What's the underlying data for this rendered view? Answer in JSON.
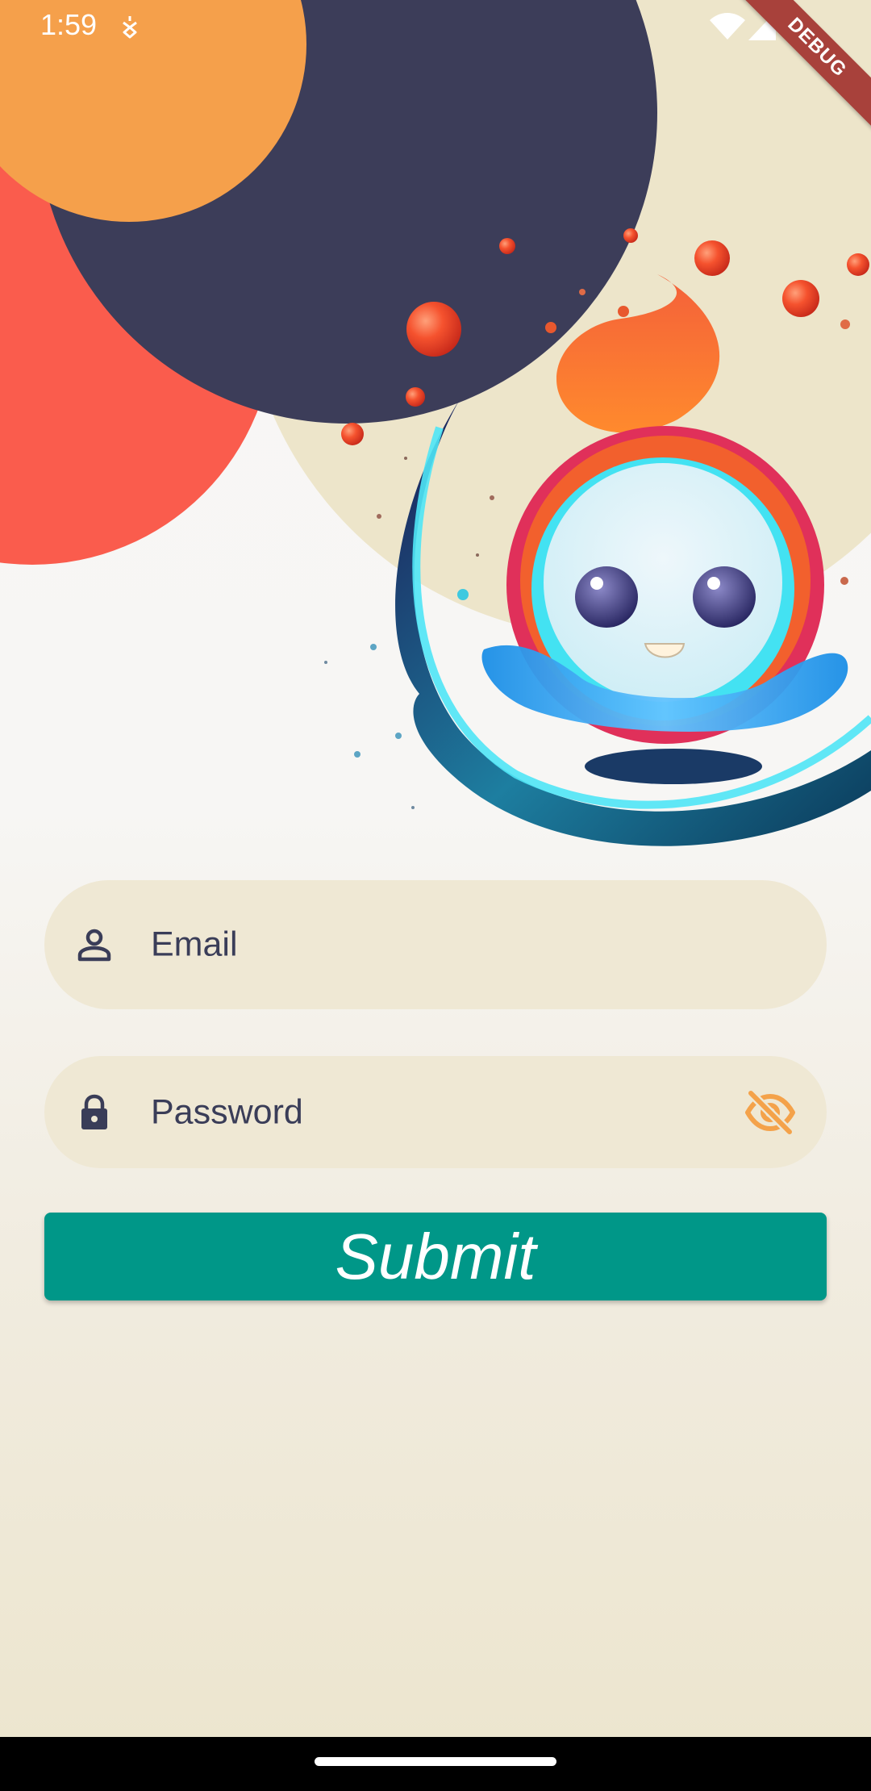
{
  "status_bar": {
    "time": "1:59",
    "icons": [
      "notification-icon",
      "wifi-icon",
      "signal-icon"
    ]
  },
  "debug_banner": {
    "label": "DEBUG"
  },
  "login_form": {
    "email": {
      "placeholder": "Email",
      "value": "",
      "icon": "person-icon"
    },
    "password": {
      "placeholder": "Password",
      "value": "",
      "icon": "lock-icon",
      "toggle_icon": "eye-off-icon"
    },
    "submit_label": "Submit"
  },
  "colors": {
    "accent_orange": "#f5a04b",
    "accent_red": "#fa5c4d",
    "dark_navy": "#3c3d59",
    "cream": "#efe8d4",
    "submit_teal": "#009788",
    "toggle_orange": "#f4a24a"
  }
}
